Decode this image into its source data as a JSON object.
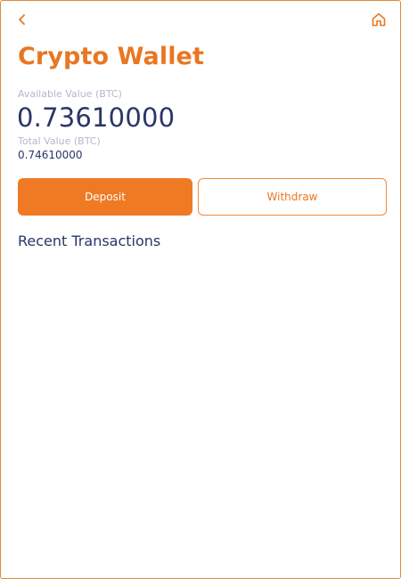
{
  "header": {
    "back_icon": "chevron-left-icon",
    "home_icon": "home-icon",
    "accent_color": "#e87722"
  },
  "wallet": {
    "title": "Crypto Wallet",
    "available_label": "Available Value (BTC)",
    "available_value": "0.73610000",
    "total_label": "Total Value (BTC)",
    "total_value": "0.74610000"
  },
  "actions": {
    "deposit_label": "Deposit",
    "withdraw_label": "Withdraw"
  },
  "transactions": {
    "title": "Recent Transactions",
    "items": []
  }
}
